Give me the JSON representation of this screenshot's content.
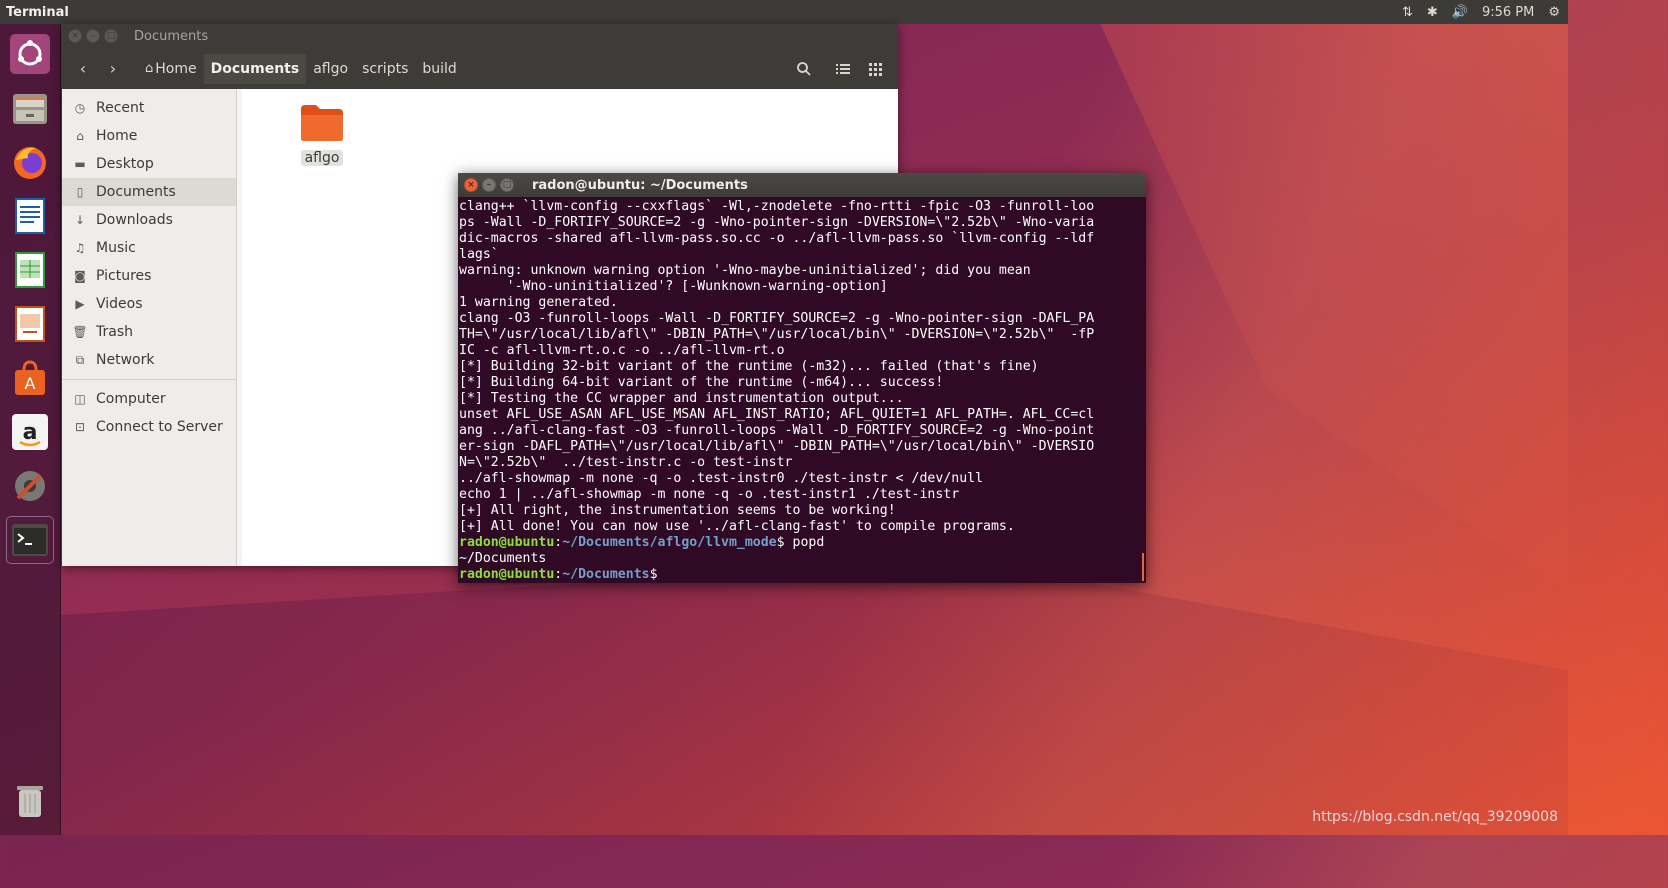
{
  "top_panel": {
    "app_title": "Terminal",
    "clock": "9:56 PM"
  },
  "launcher": {
    "items": [
      "ubuntu-dash",
      "files",
      "firefox",
      "libreoffice-writer",
      "libreoffice-calc",
      "libreoffice-impress",
      "ubuntu-software",
      "amazon",
      "system-settings",
      "terminal",
      "trash"
    ]
  },
  "files_window": {
    "title": "Documents",
    "breadcrumbs": [
      "Home",
      "Documents",
      "aflgo",
      "scripts",
      "build"
    ],
    "sidebar": {
      "places": [
        "Recent",
        "Home",
        "Desktop",
        "Documents",
        "Downloads",
        "Music",
        "Pictures",
        "Videos",
        "Trash",
        "Network"
      ],
      "devices": [
        "Computer",
        "Connect to Server"
      ]
    },
    "items": [
      {
        "name": "aflgo"
      }
    ]
  },
  "terminal": {
    "title": "radon@ubuntu: ~/Documents",
    "lines": [
      "clang++ `llvm-config --cxxflags` -Wl,-znodelete -fno-rtti -fpic -O3 -funroll-loo",
      "ps -Wall -D_FORTIFY_SOURCE=2 -g -Wno-pointer-sign -DVERSION=\\\"2.52b\\\" -Wno-varia",
      "dic-macros -shared afl-llvm-pass.so.cc -o ../afl-llvm-pass.so `llvm-config --ldf",
      "lags`",
      "warning: unknown warning option '-Wno-maybe-uninitialized'; did you mean",
      "      '-Wno-uninitialized'? [-Wunknown-warning-option]",
      "1 warning generated.",
      "clang -O3 -funroll-loops -Wall -D_FORTIFY_SOURCE=2 -g -Wno-pointer-sign -DAFL_PA",
      "TH=\\\"/usr/local/lib/afl\\\" -DBIN_PATH=\\\"/usr/local/bin\\\" -DVERSION=\\\"2.52b\\\"  -fP",
      "IC -c afl-llvm-rt.o.c -o ../afl-llvm-rt.o",
      "[*] Building 32-bit variant of the runtime (-m32)... failed (that's fine)",
      "[*] Building 64-bit variant of the runtime (-m64)... success!",
      "[*] Testing the CC wrapper and instrumentation output...",
      "unset AFL_USE_ASAN AFL_USE_MSAN AFL_INST_RATIO; AFL_QUIET=1 AFL_PATH=. AFL_CC=cl",
      "ang ../afl-clang-fast -O3 -funroll-loops -Wall -D_FORTIFY_SOURCE=2 -g -Wno-point",
      "er-sign -DAFL_PATH=\\\"/usr/local/lib/afl\\\" -DBIN_PATH=\\\"/usr/local/bin\\\" -DVERSIO",
      "N=\\\"2.52b\\\"  ../test-instr.c -o test-instr",
      "../afl-showmap -m none -q -o .test-instr0 ./test-instr < /dev/null",
      "echo 1 | ../afl-showmap -m none -q -o .test-instr1 ./test-instr",
      "[+] All right, the instrumentation seems to be working!",
      "[+] All done! You can now use '../afl-clang-fast' to compile programs."
    ],
    "prompt1": {
      "user": "radon@ubuntu",
      "path": "~/Documents/aflgo/llvm_mode",
      "cmd": " popd"
    },
    "output_after": "~/Documents",
    "prompt2": {
      "user": "radon@ubuntu",
      "path": "~/Documents",
      "cmd": ""
    }
  },
  "watermark": "https://blog.csdn.net/qq_39209008"
}
